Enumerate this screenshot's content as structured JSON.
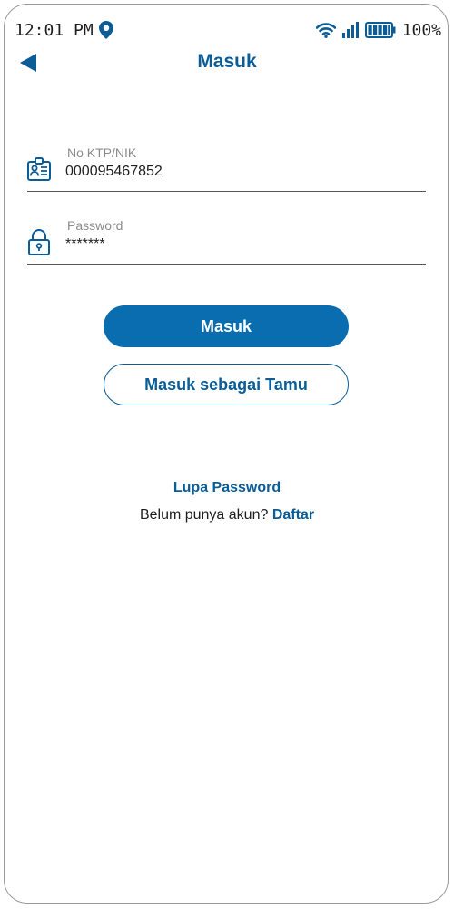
{
  "status_bar": {
    "time": "12:01 PM",
    "battery": "100%",
    "icons": [
      "location-icon",
      "wifi-icon",
      "signal-icon",
      "battery-icon"
    ]
  },
  "header": {
    "title": "Masuk",
    "back_icon": "back-arrow-icon"
  },
  "form": {
    "nik": {
      "label": "No KTP/NIK",
      "value": "000095467852",
      "icon": "id-card-icon"
    },
    "password": {
      "label": "Password",
      "value": "*******",
      "icon": "lock-icon"
    }
  },
  "buttons": {
    "login": "Masuk",
    "guest": "Masuk sebagai Tamu"
  },
  "links": {
    "forgot_password": "Lupa Password",
    "register_prompt": "Belum punya akun?",
    "register": "Daftar"
  },
  "colors": {
    "brand": "#0a5d97",
    "primary_button": "#0a6db0"
  }
}
